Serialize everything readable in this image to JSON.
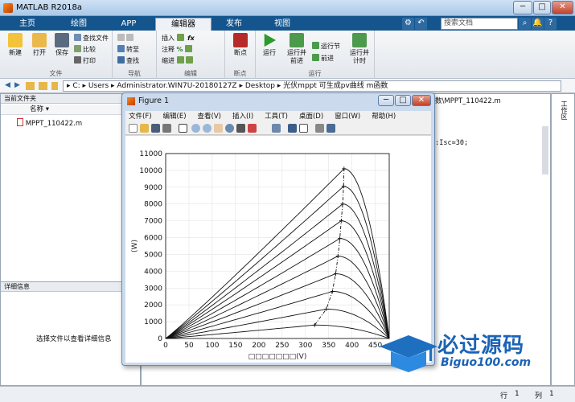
{
  "window": {
    "title": "MATLAB R2018a",
    "minimize": "─",
    "restore": "□",
    "close": "✕"
  },
  "tabs": [
    "主页",
    "绘图",
    "APP",
    "编辑器",
    "发布",
    "视图"
  ],
  "search": {
    "placeholder": "搜索文档"
  },
  "ribbon": {
    "file": {
      "label": "文件",
      "new": "新建",
      "open": "打开",
      "save": "保存",
      "find_files": "查找文件",
      "compare": "比较",
      "print": "打印"
    },
    "nav": {
      "label": "导航",
      "goto": "转至",
      "find": "查找"
    },
    "edit": {
      "label": "编辑",
      "insert": "插入",
      "comment": "注释",
      "indent": "缩进"
    },
    "breakpoints": {
      "label": "断点",
      "bp": "断点"
    },
    "run": {
      "label": "运行",
      "run": "运行",
      "run_advance": "运行并\n前进",
      "run_section": "运行节",
      "advance": "前进",
      "run_time": "运行并\n计时"
    }
  },
  "address": {
    "path": "▸ C: ▸ Users ▸ Administrator.WIN7U-20180127Z ▸ Desktop ▸ 光伏mppt 可生成pv曲线 m函数"
  },
  "current_folder": {
    "title": "当前文件夹",
    "col_name": "名称 ▾",
    "file": "MPPT_110422.m"
  },
  "details": {
    "title": "详细信息",
    "hint": "选择文件以查看详细信息"
  },
  "editor": {
    "tab": "数\\MPPT_110422.m",
    "code_line": "6:Isc=30;"
  },
  "side_label": "工作区",
  "figure": {
    "title": "Figure 1",
    "menu": [
      "文件(F)",
      "编辑(E)",
      "查看(V)",
      "插入(I)",
      "工具(T)",
      "桌面(D)",
      "窗口(W)",
      "帮助(H)"
    ],
    "ylabel": "(W)",
    "xlabel": "□□□□□□□(V)"
  },
  "status": {
    "row_label": "行",
    "row": "1",
    "col_label": "列",
    "col": "1"
  },
  "watermark": {
    "cn": "必过源码",
    "en": "Biguo100.com"
  },
  "chart_data": {
    "type": "line",
    "xlabel": "□□□□□□□(V)",
    "ylabel": "(W)",
    "xlim": [
      0,
      480
    ],
    "ylim": [
      0,
      11000
    ],
    "xticks": [
      0,
      50,
      100,
      150,
      200,
      250,
      300,
      350,
      400,
      450
    ],
    "yticks": [
      0,
      1000,
      2000,
      3000,
      4000,
      5000,
      6000,
      7000,
      8000,
      9000,
      10000,
      11000
    ],
    "grid": true,
    "voc": 480,
    "series": [
      {
        "peak_v": 320,
        "peak_p": 800
      },
      {
        "peak_v": 345,
        "peak_p": 1750
      },
      {
        "peak_v": 358,
        "peak_p": 2800
      },
      {
        "peak_v": 365,
        "peak_p": 3850
      },
      {
        "peak_v": 370,
        "peak_p": 4900
      },
      {
        "peak_v": 374,
        "peak_p": 5950
      },
      {
        "peak_v": 377,
        "peak_p": 7000
      },
      {
        "peak_v": 380,
        "peak_p": 8000
      },
      {
        "peak_v": 382,
        "peak_p": 9050
      },
      {
        "peak_v": 383,
        "peak_p": 10100
      }
    ],
    "mpp_trace": {
      "x": [
        320,
        345,
        358,
        365,
        370,
        374,
        377,
        380,
        382,
        383
      ],
      "y": [
        800,
        1750,
        2800,
        3850,
        4900,
        5950,
        7000,
        8000,
        9050,
        10100
      ]
    }
  }
}
